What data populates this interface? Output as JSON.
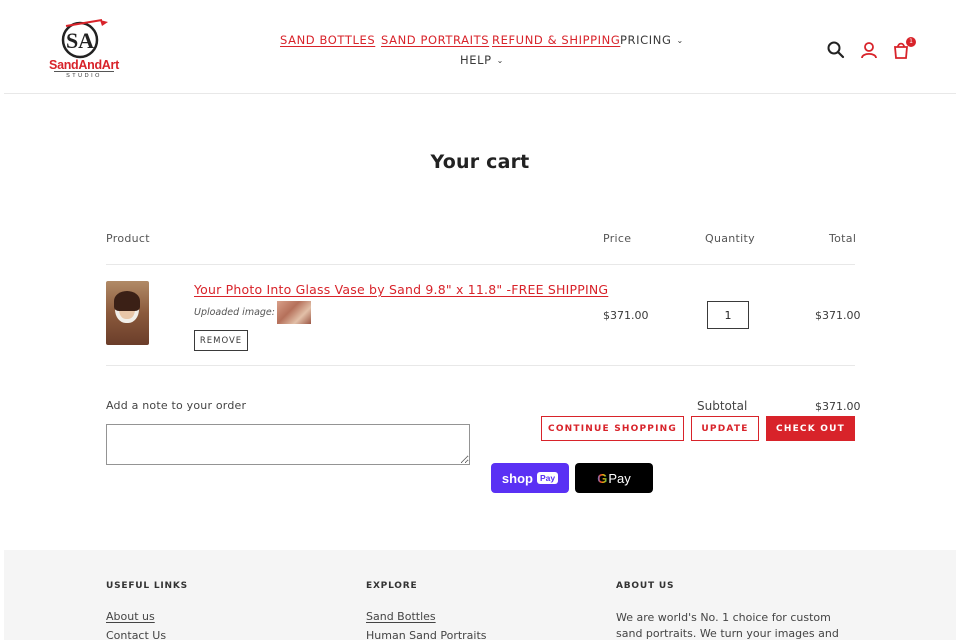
{
  "brand": {
    "logo_text": "SandAndArt",
    "logo_subtext": "STUDIO",
    "logo_monogram": "SA",
    "accent_color": "#d8232a"
  },
  "nav": {
    "items": [
      {
        "label": "SAND BOTTLES"
      },
      {
        "label": "SAND PORTRAITS"
      },
      {
        "label": "REFUND & SHIPPING"
      },
      {
        "label": "PRICING"
      },
      {
        "label": "HELP"
      }
    ],
    "icons": [
      "search-icon",
      "account-icon",
      "cart-icon"
    ],
    "cart_count": "1"
  },
  "cart": {
    "title": "Your cart",
    "columns": {
      "product": "Product",
      "price": "Price",
      "quantity": "Quantity",
      "total": "Total"
    },
    "items": [
      {
        "name": "Your Photo Into Glass Vase by Sand 9.8\" x 11.8\" -FREE SHIPPING",
        "uploaded_label": "Uploaded image:",
        "remove_label": "REMOVE",
        "price": "$371.00",
        "quantity": "1",
        "total": "$371.00"
      }
    ],
    "note_label": "Add a note to your order",
    "subtotal_label": "Subtotal",
    "subtotal": "$371.00",
    "buttons": {
      "continue": "CONTINUE SHOPPING",
      "update": "UPDATE",
      "checkout": "CHECK OUT"
    },
    "express": {
      "shop": "shop",
      "shop_pay": "Pay",
      "google_g": "G",
      "google_pay": "Pay"
    }
  },
  "footer": {
    "useful_links": {
      "heading": "USEFUL LINKS",
      "links": [
        "About us",
        "Contact Us"
      ]
    },
    "explore": {
      "heading": "EXPLORE",
      "links": [
        "Sand Bottles",
        "Human Sand Portraits"
      ]
    },
    "about": {
      "heading": "ABOUT US",
      "text": "We are world's No. 1 choice for custom sand portraits. We turn your images and"
    }
  }
}
